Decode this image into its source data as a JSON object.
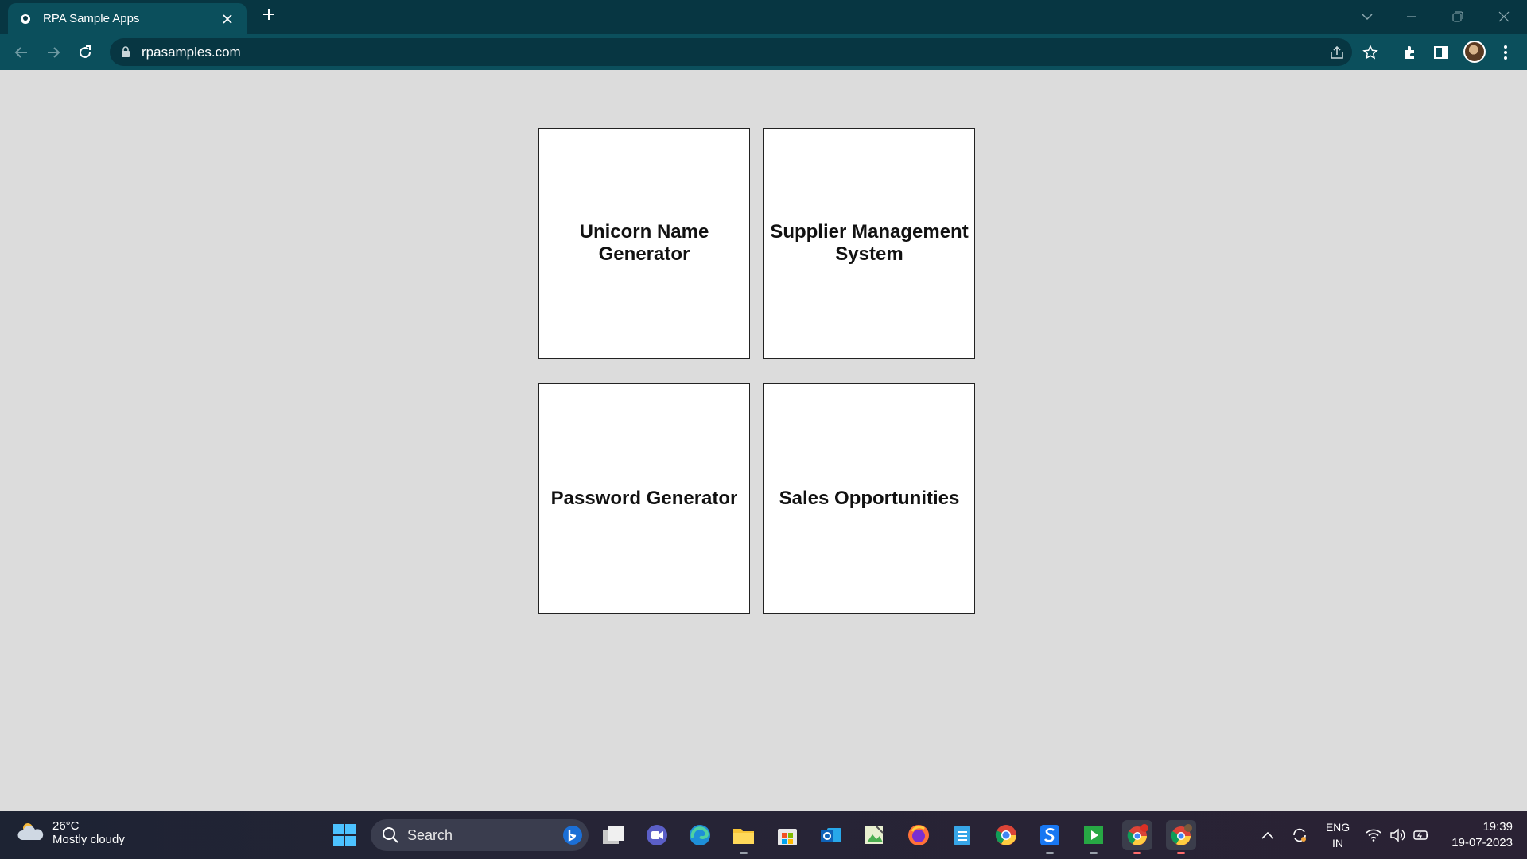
{
  "browser": {
    "tab_title": "RPA Sample Apps",
    "url": "rpasamples.com",
    "colors": {
      "tabstrip": "#073642",
      "toolbar": "#0b4f5c"
    }
  },
  "page": {
    "cards": [
      {
        "label": "Unicorn Name Generator"
      },
      {
        "label": "Supplier Management System"
      },
      {
        "label": "Password Generator"
      },
      {
        "label": "Sales Opportunities"
      }
    ]
  },
  "taskbar": {
    "weather": {
      "temp": "26°C",
      "desc": "Mostly cloudy"
    },
    "search_label": "Search",
    "apps": [
      "start-icon",
      "search-icon",
      "bing-icon",
      "task-view-icon",
      "teams-icon",
      "edge-icon",
      "file-explorer-icon",
      "store-icon",
      "outlook-icon",
      "image-app-icon",
      "firefox-icon",
      "notepad-icon",
      "chrome-icon",
      "app-s-icon",
      "media-icon",
      "chrome-profile-r-icon",
      "chrome-profile-icon"
    ],
    "lang": {
      "line1": "ENG",
      "line2": "IN"
    },
    "clock": {
      "time": "19:39",
      "date": "19-07-2023"
    }
  }
}
